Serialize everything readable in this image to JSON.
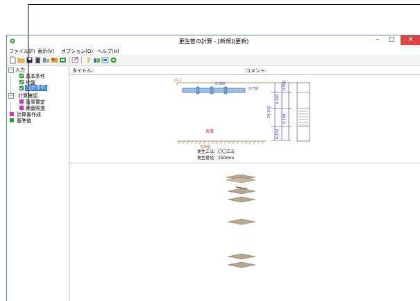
{
  "window": {
    "title": "更生管の計算 - [新規](更新)",
    "min_glyph": "–",
    "max_glyph": "□",
    "close_glyph": "×"
  },
  "menu": [
    {
      "label": "ファイル(F)"
    },
    {
      "label": "表示(V)"
    },
    {
      "label": "オプション(O)"
    },
    {
      "label": "ヘルプ(H)"
    }
  ],
  "toolbar": {
    "icons": [
      "new-file-icon",
      "open-folder-icon",
      "save-icon",
      "delete-icon",
      "tool-icon-a",
      "tool-icon-b",
      "tool-icon-c",
      "tool-icon-d",
      "help-icon",
      "tool-icon-e",
      "tool-icon-f",
      "tool-icon-g"
    ]
  },
  "tree": {
    "input": "入力",
    "basic": "基本条件",
    "ground": "地盤",
    "design": "設計条件",
    "calc_check": "計算確認",
    "pipe_thickness": "管厚算定",
    "quake_check": "耐震照査",
    "report": "計算書作成",
    "standard": "基準値"
  },
  "header": {
    "title_label": "タイトル:",
    "comment_label": "コメント:"
  },
  "diagram": {
    "gl_label": "G.L",
    "surface_layer": "表層",
    "method_line": "更生工法：〇〇工法",
    "diameter_line": "更生管径：250mm",
    "dim_left": "0.350",
    "dim_right": "0.750",
    "dim_mid_left": "24.700",
    "dim_mid_right": "4.150",
    "dim_bottom_left": "4.150",
    "dim_small": "0.500",
    "dim_right_top": "8.100",
    "bottom_label": "支持層"
  },
  "colors": {
    "check_green": "#2e9b2e",
    "check_pink": "#d32fb8",
    "selected_bg": "#3b7fd9",
    "close_red": "#e04343",
    "pipe_blue": "#6f9fd6",
    "dim_blue": "#2a2ad0",
    "hatch_brown": "#9a6a3a",
    "layer_tan": "#b9a48c"
  }
}
